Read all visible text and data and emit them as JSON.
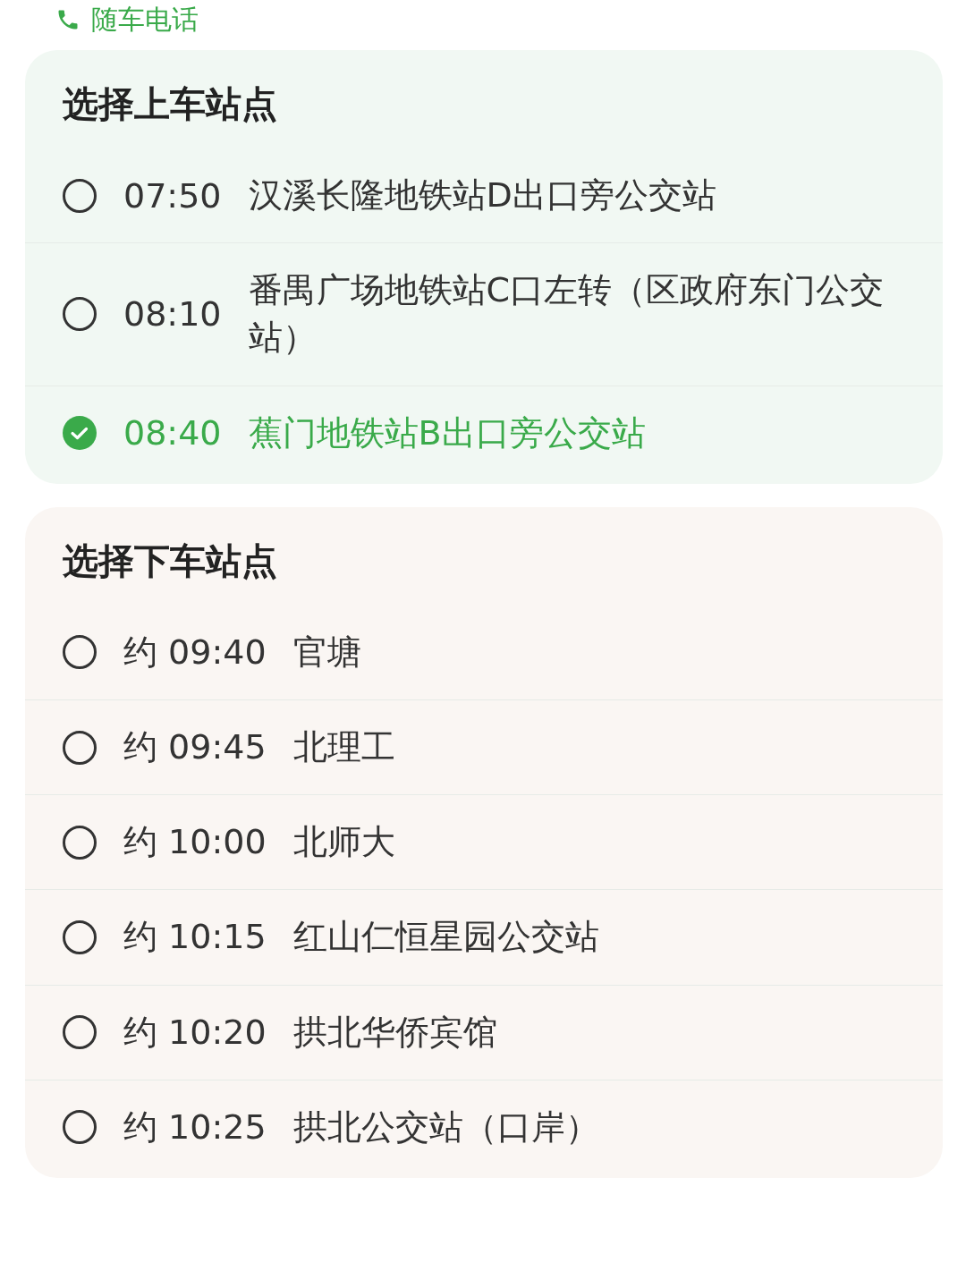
{
  "phone_link": {
    "label": "随车电话"
  },
  "sections": [
    {
      "kind": "boarding",
      "title": "选择上车站点",
      "stops": [
        {
          "time": "07:50",
          "name": "汉溪长隆地铁站D出口旁公交站",
          "selected": false
        },
        {
          "time": "08:10",
          "name": "番禺广场地铁站C口左转（区政府东门公交站）",
          "selected": false
        },
        {
          "time": "08:40",
          "name": "蕉门地铁站B出口旁公交站",
          "selected": true
        }
      ]
    },
    {
      "kind": "alighting",
      "title": "选择下车站点",
      "stops": [
        {
          "time": "约 09:40",
          "name": "官塘",
          "selected": false
        },
        {
          "time": "约 09:45",
          "name": "北理工",
          "selected": false
        },
        {
          "time": "约 10:00",
          "name": "北师大",
          "selected": false
        },
        {
          "time": "约 10:15",
          "name": "红山仁恒星园公交站",
          "selected": false
        },
        {
          "time": "约 10:20",
          "name": "拱北华侨宾馆",
          "selected": false
        },
        {
          "time": "约 10:25",
          "name": "拱北公交站（口岸）",
          "selected": false
        }
      ]
    }
  ]
}
